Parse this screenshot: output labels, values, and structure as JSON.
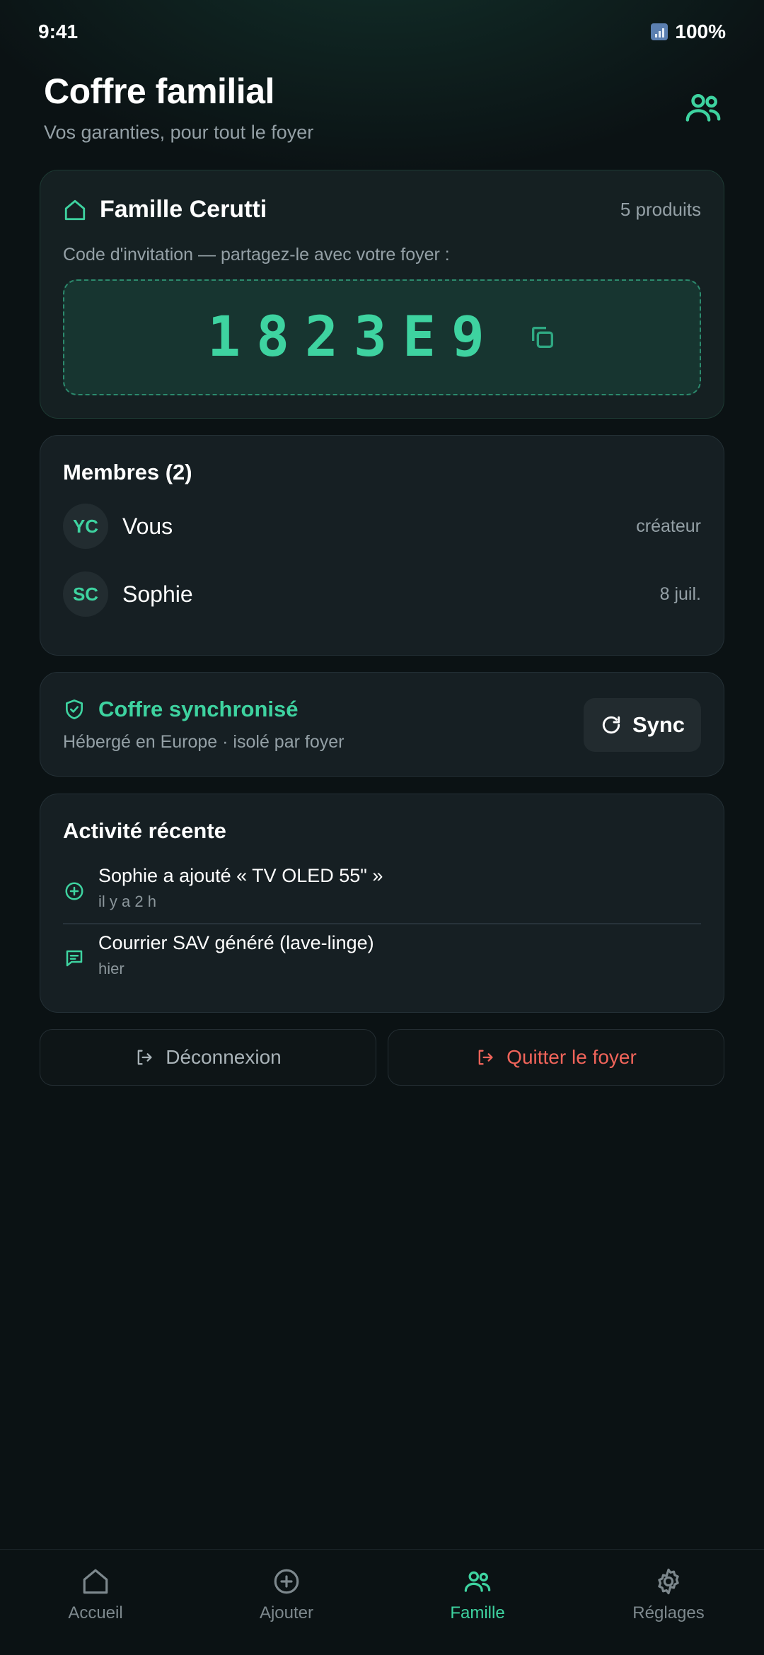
{
  "status_bar": {
    "time": "9:41",
    "battery": "100%"
  },
  "header": {
    "title": "Coffre familial",
    "subtitle": "Vos garanties, pour tout le foyer"
  },
  "family": {
    "name": "Famille Cerutti",
    "product_count": "5 produits",
    "invite_label": "Code d'invitation — partagez-le avec votre foyer :",
    "invite_code": "1823E9"
  },
  "members": {
    "title": "Membres (2)",
    "items": [
      {
        "initials": "YC",
        "name": "Vous",
        "meta": "créateur"
      },
      {
        "initials": "SC",
        "name": "Sophie",
        "meta": "8 juil."
      }
    ]
  },
  "sync": {
    "title": "Coffre synchronisé",
    "subtitle": "Hébergé en Europe · isolé par foyer",
    "button_label": "Sync"
  },
  "activity": {
    "title": "Activité récente",
    "items": [
      {
        "icon": "plus-circle-icon",
        "text": "Sophie a ajouté « TV OLED 55\" »",
        "time": "il y a 2 h"
      },
      {
        "icon": "message-icon",
        "text": "Courrier SAV généré (lave-linge)",
        "time": "hier"
      }
    ]
  },
  "actions": {
    "logout_label": "Déconnexion",
    "quit_label": "Quitter le foyer"
  },
  "tabs": [
    {
      "label": "Accueil",
      "icon": "home-icon"
    },
    {
      "label": "Ajouter",
      "icon": "plus-circle-icon"
    },
    {
      "label": "Famille",
      "icon": "users-icon"
    },
    {
      "label": "Réglages",
      "icon": "gear-icon"
    }
  ],
  "colors": {
    "accent": "#3ed3a0",
    "danger": "#f0645a",
    "background": "#0b1214",
    "card": "#161f23"
  }
}
